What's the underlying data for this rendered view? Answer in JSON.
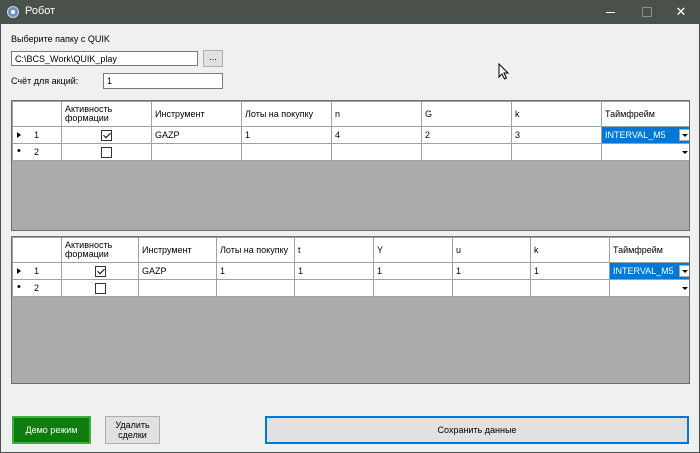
{
  "window": {
    "title": "Робот",
    "close_glyph": "✕"
  },
  "folder": {
    "label": "Выберите папку с QUIK",
    "path": "C:\\BCS_Work\\QUIK_play",
    "browse_label": "..."
  },
  "account": {
    "label": "Счёт для акций:",
    "value": "1"
  },
  "grid1": {
    "headers": [
      "",
      "Активность формации",
      "Инструмент",
      "Лоты на покупку",
      "n",
      "G",
      "k",
      "Таймфрейм"
    ],
    "rows": [
      {
        "num": "1",
        "checked": true,
        "instrument": "GAZP",
        "lots": "1",
        "a": "4",
        "b": "2",
        "c": "3",
        "timeframe": "INTERVAL_M5"
      },
      {
        "num": "2",
        "checked": false,
        "instrument": "",
        "lots": "",
        "a": "",
        "b": "",
        "c": "",
        "timeframe": ""
      }
    ]
  },
  "grid2": {
    "headers": [
      "",
      "Активность формации",
      "Инструмент",
      "Лоты на покупку",
      "t",
      "Y",
      "u",
      "k",
      "Таймфрейм"
    ],
    "rows": [
      {
        "num": "1",
        "checked": true,
        "instrument": "GAZP",
        "lots": "1",
        "a": "1",
        "b": "1",
        "c": "1",
        "d": "1",
        "timeframe": "INTERVAL_M5"
      },
      {
        "num": "2",
        "checked": false,
        "instrument": "",
        "lots": "",
        "a": "",
        "b": "",
        "c": "",
        "d": "",
        "timeframe": ""
      }
    ]
  },
  "buttons": {
    "demo": "Демо режим",
    "delete_line1": "Удалить",
    "delete_line2": "сделки",
    "save": "Сохранить данные"
  },
  "colors": {
    "accent": "#0078d7",
    "demo_bg": "#0d7d0d",
    "grid_bg": "#ababab",
    "titlebar": "#4a514a"
  }
}
